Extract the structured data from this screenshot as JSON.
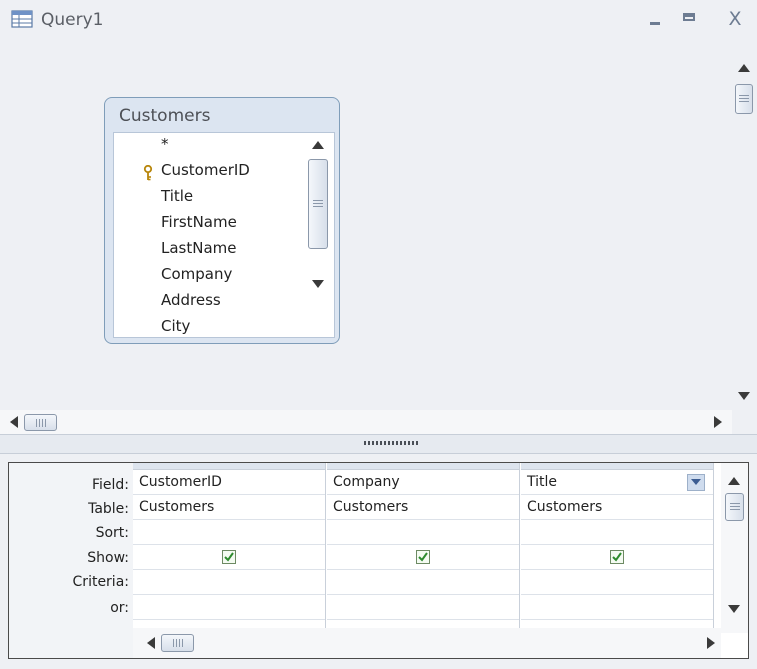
{
  "window": {
    "title": "Query1",
    "icons": {
      "app": "query-icon",
      "minimize": "minimize-icon",
      "maximize": "maximize-icon",
      "close": "close-icon"
    },
    "close_label": "X"
  },
  "table": {
    "name": "Customers",
    "fields": [
      "*",
      "CustomerID",
      "Title",
      "FirstName",
      "LastName",
      "Company",
      "Address",
      "City"
    ],
    "primary_key": "CustomerID"
  },
  "grid": {
    "row_labels": [
      "Field:",
      "Table:",
      "Sort:",
      "Show:",
      "Criteria:",
      "or:"
    ],
    "columns": [
      {
        "field": "CustomerID",
        "table": "Customers",
        "sort": "",
        "show": true,
        "criteria": "",
        "or": ""
      },
      {
        "field": "Company",
        "table": "Customers",
        "sort": "",
        "show": true,
        "criteria": "",
        "or": ""
      },
      {
        "field": "Title",
        "table": "Customers",
        "sort": "",
        "show": true,
        "criteria": "",
        "or": "",
        "dropdown": true
      }
    ]
  },
  "colors": {
    "accent": "#3b5c92",
    "check": "#2e8b2e",
    "border": "#7f9db9"
  }
}
